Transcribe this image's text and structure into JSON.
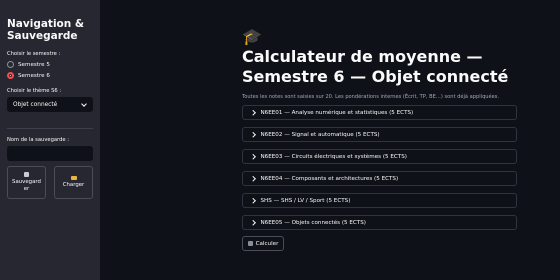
{
  "sidebar": {
    "title": "Navigation & Sauvegarde",
    "semester_label": "Choisir le semestre :",
    "semesters": [
      "Semestre 5",
      "Semestre 6"
    ],
    "selected_semester": "Semestre 6",
    "theme_label": "Choisir le thème S6 :",
    "theme_value": "Objet connecté",
    "save_name_label": "Nom de la sauvegarde :",
    "save_name_value": "",
    "save_button": "Sauvegarder",
    "load_button": "Charger"
  },
  "main": {
    "title": "Calculateur de moyenne — Semestre 6 — Objet connecté",
    "subtitle": "Toutes les notes sont saisies sur 20. Les pondérations internes (Écrit, TP, BE…) sont déjà appliquées.",
    "modules": [
      "N6EE01 — Analyse numérique et statistiques (5 ECTS)",
      "N6EE02 — Signal et automatique (5 ECTS)",
      "N6EE03 — Circuits électriques et systèmes (5 ECTS)",
      "N6EE04 — Composants et architectures (5 ECTS)",
      "SHS — SHS / LV / Sport (5 ECTS)",
      "N6EE05 — Objets connectés (5 ECTS)"
    ],
    "calculate_button": "Calculer"
  },
  "icons": {
    "title": "graduation-cap-icon",
    "save": "floppy-disk-icon",
    "load": "folder-icon",
    "calculate": "abacus-icon"
  },
  "colors": {
    "accent": "#ff4b4b",
    "background": "#0e1117",
    "sidebar": "#262730"
  }
}
